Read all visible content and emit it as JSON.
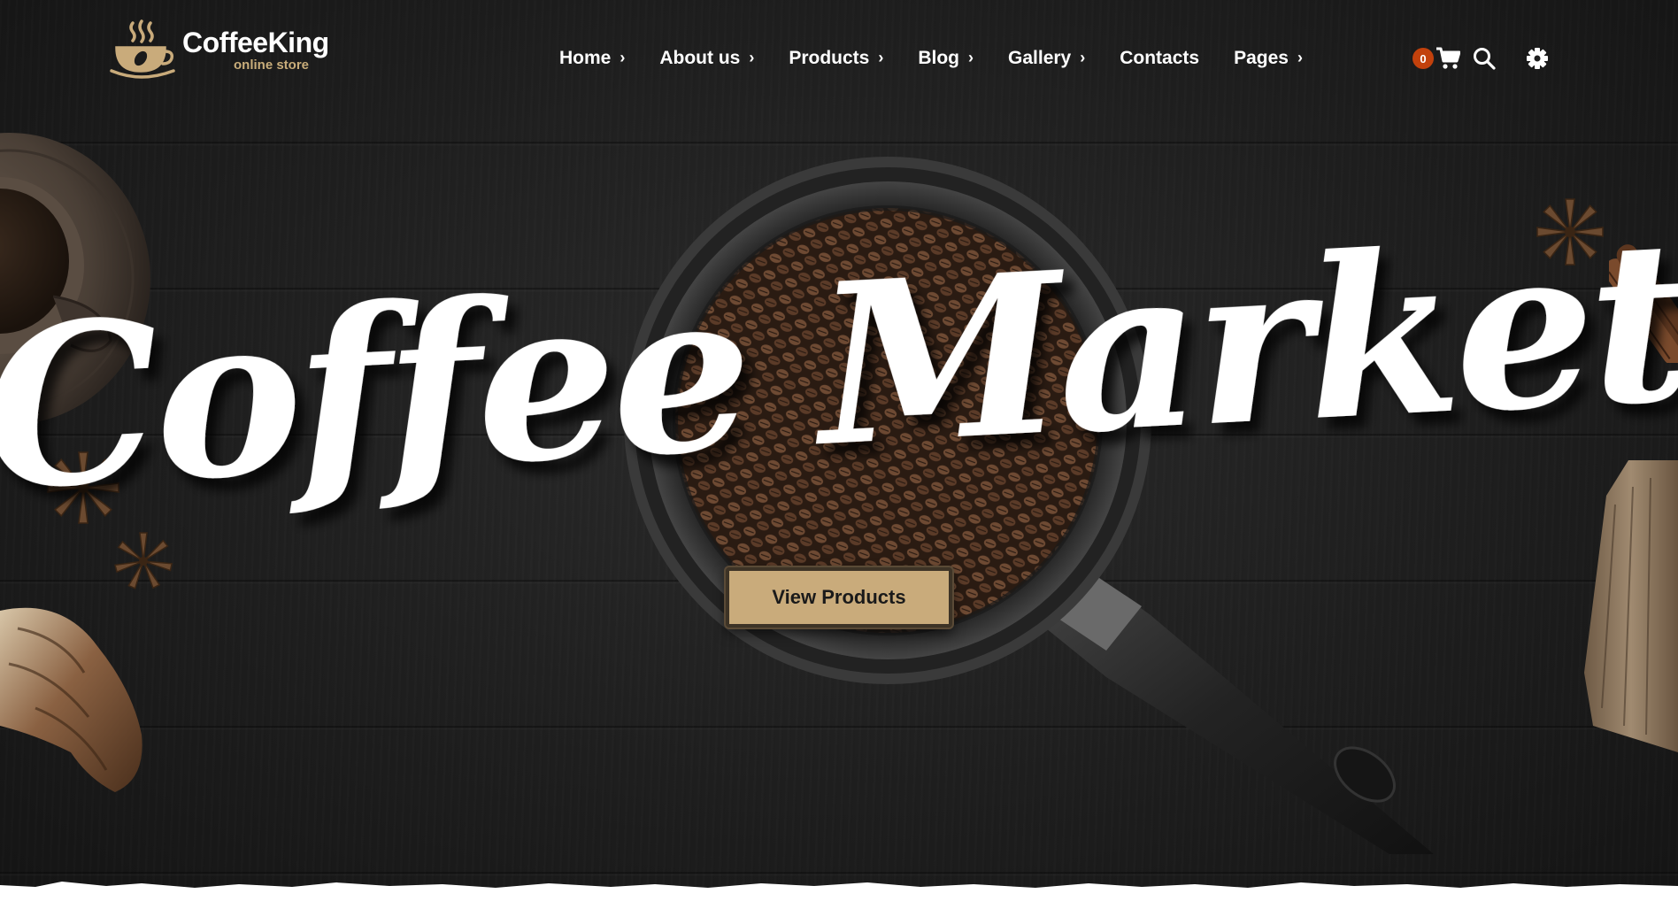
{
  "brand": {
    "name": "CoffeeKing",
    "tagline": "online store",
    "accent_color": "#c9ab7b",
    "logo_icon": "coffee-cup-icon"
  },
  "nav": {
    "items": [
      {
        "label": "Home",
        "has_submenu": true
      },
      {
        "label": "About us",
        "has_submenu": true
      },
      {
        "label": "Products",
        "has_submenu": true
      },
      {
        "label": "Blog",
        "has_submenu": true
      },
      {
        "label": "Gallery",
        "has_submenu": true
      },
      {
        "label": "Contacts",
        "has_submenu": false
      },
      {
        "label": "Pages",
        "has_submenu": true
      }
    ],
    "submenu_icon": "chevron-right-icon"
  },
  "tools": {
    "cart_count": "0",
    "cart_badge_color": "#c2410c",
    "cart_icon": "cart-icon",
    "search_icon": "search-icon",
    "settings_icon": "gear-icon"
  },
  "hero": {
    "headline": "Coffee Market",
    "cta_label": "View Products",
    "background_color": "#1e1e1e"
  }
}
